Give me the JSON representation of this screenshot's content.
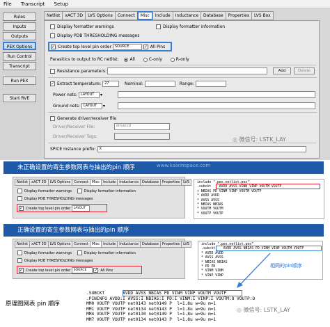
{
  "menu": [
    "File",
    "Transcript",
    "Setup"
  ],
  "sidebar": [
    "Rules",
    "Inputs",
    "Outputs",
    "PEX Options",
    "Run Control",
    "Transcript",
    "Run PEX",
    "Start RVE"
  ],
  "tabs": [
    "Netlist",
    "xACT 3D",
    "LVS Options",
    "Connect",
    "Misc",
    "Include",
    "Inductance",
    "Database",
    "Properties",
    "LVS Box"
  ],
  "options": {
    "display_warnings": "Display formatter warnings",
    "display_info": "Display formatter information",
    "display_pdb": "Display PDB THRESHOLDING messages",
    "create_top_level": "Create top level pin order",
    "source": "SOURCE",
    "all_pins": "All Pins",
    "parasitics_label": "Parasitics to output to RC netlist:",
    "parasitics_opts": [
      "All",
      "C-only",
      "R-only"
    ],
    "resistance": "Resistance parameters:",
    "add": "Add",
    "delete": "Delete",
    "extract_temp": "Extract temperature:",
    "extract_temp_val": "27",
    "nominal": "Nominal:",
    "range": "Range:",
    "power_nets": "Power nets:",
    "ground_nets": "Ground nets:",
    "layout": "LAYOUT",
    "generate": "Generate driver/receiver file",
    "drv_file": "Driver/Receiver File:",
    "drv_file_val": "driver.rd",
    "drv_tags": "Driver/Receiver Tags:",
    "spice_prefix": "SPICE instance prefix:",
    "spice_prefix_val": "X"
  },
  "watermark": "微信号: LSTK_LAY",
  "site": "www.kaixinspace.com",
  "wrong_title": "未正确设置的寄生参数网表与抽出的pin 顺序",
  "right_title": "正确设置的寄生参数网表与抽出的pin 顺序",
  "mini_tabs": [
    "Netlist",
    "xACT 3D",
    "LVS Options",
    "Connect",
    "Misc",
    "Include",
    "Inductance",
    "Database",
    "Properties",
    "LVS"
  ],
  "wrong_netlist": [
    "include \".pex.netlist.pex\"",
    ".subckt    AVDD AVSS VINN VINP VOUTM VOUTP",
    "+ NBIAS PD VINM VINP VOUTM VOUTP",
    "* AVDD AVDD",
    "* AVSS AVSS",
    "* NBIAS NBIAS",
    "* VOUTM VOUTM",
    "* VOUTP VOUTP",
    "* VINP VINP",
    "* VINM VINM"
  ],
  "right_netlist": [
    "include \".pex.netlist.pex\"",
    ".subckt    AVDD AVSS NBIAS PD VINM VINP VOUTM VOUTP",
    "* AVDD AVDD",
    "* AVSS AVSS",
    "* NBIAS NBIAS",
    "* PD PD",
    "* VINM VINM",
    "* VINP VINP",
    "* VOUTM VOUTM",
    "* VOUTP VOUTP"
  ],
  "same_pin": "相同的pin顺序",
  "schem_label": "原理图网表  pin 顺序",
  "subckt": [
    ".SUBCKT       AVDD AVSS NBIAS PD VINM VINP VOUTM VOUTP",
    ".PININFO AVDD:I AVSS:I NBIAS:I PD:I VINM:I VINP:I VOUTM:O VOUTP:O",
    "MM0 VOUTP VOUTP net0143 net0149 P  l=1.8u w=9u m=1",
    "MM1 VOUTP VOUTP net0134 net0143 P  l=1.8u w=9u m=1",
    "MM4 VOUTP VOUTP net0130 net0149 P  l=1.8u w=9u m=1",
    "MM7 VOUTP VOUTP net0134 net0143 P  l=1.8u w=9u m=1"
  ]
}
